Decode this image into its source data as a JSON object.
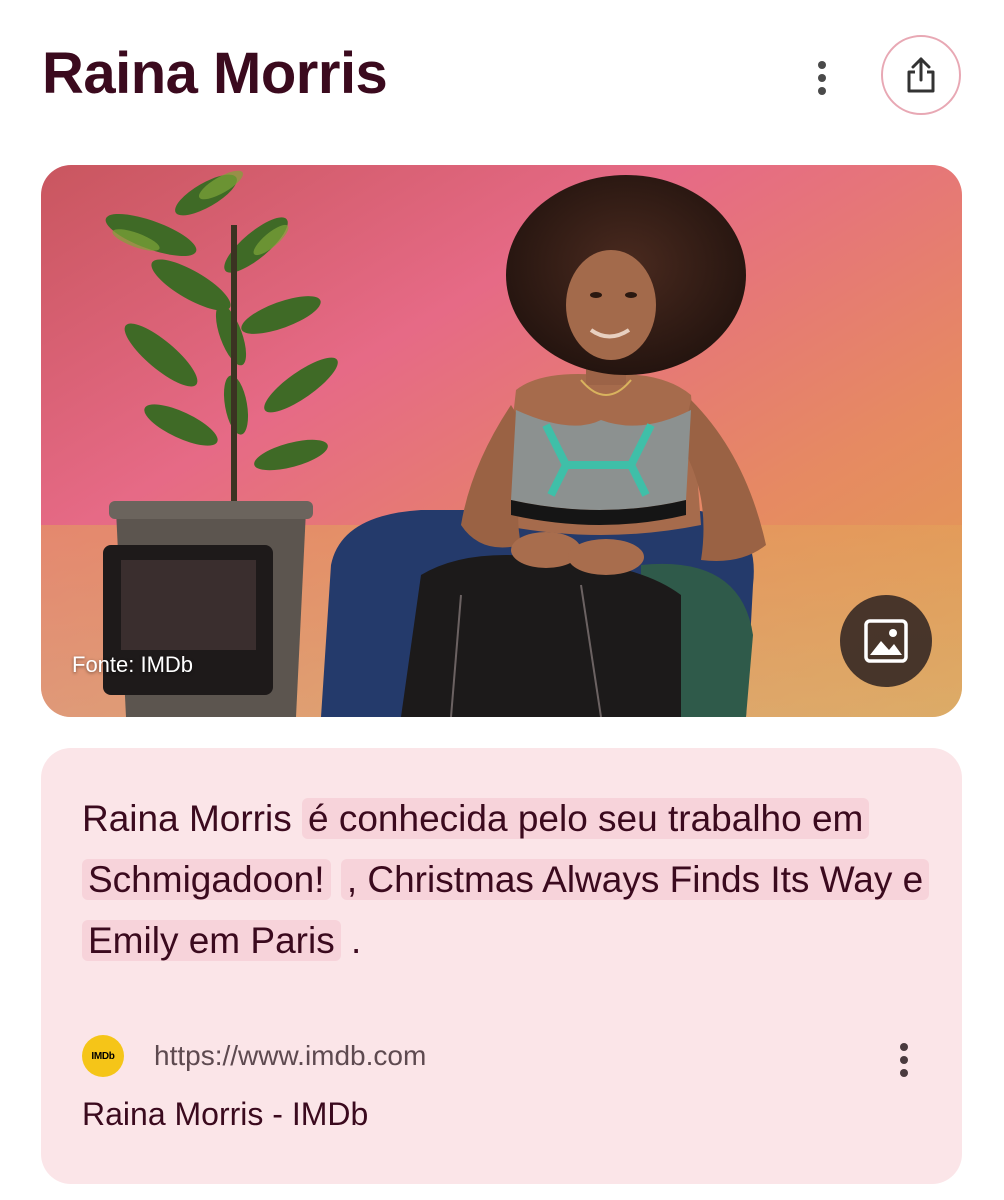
{
  "header": {
    "title": "Raina Morris",
    "more_icon": "more-vert-icon",
    "share_icon": "share-icon"
  },
  "hero": {
    "source_label": "Fonte: IMDb",
    "image_button_icon": "image-icon"
  },
  "summary": {
    "name": "Raina Morris",
    "part1": "é conhecida pelo seu trabalho em Schmigadoon!",
    "part2": ", Christmas Always Finds Its Way e Emily em Paris",
    "end": "."
  },
  "source": {
    "favicon_text": "IMDb",
    "url": "https://www.imdb.com",
    "link_title": "Raina Morris - IMDb",
    "more_icon": "more-vert-icon"
  },
  "colors": {
    "title": "#3b0a1e",
    "card_bg": "#fbe5e8",
    "highlight": "#f7d3da",
    "share_border": "#e8a8b4",
    "imdb_yellow": "#f5c518"
  }
}
